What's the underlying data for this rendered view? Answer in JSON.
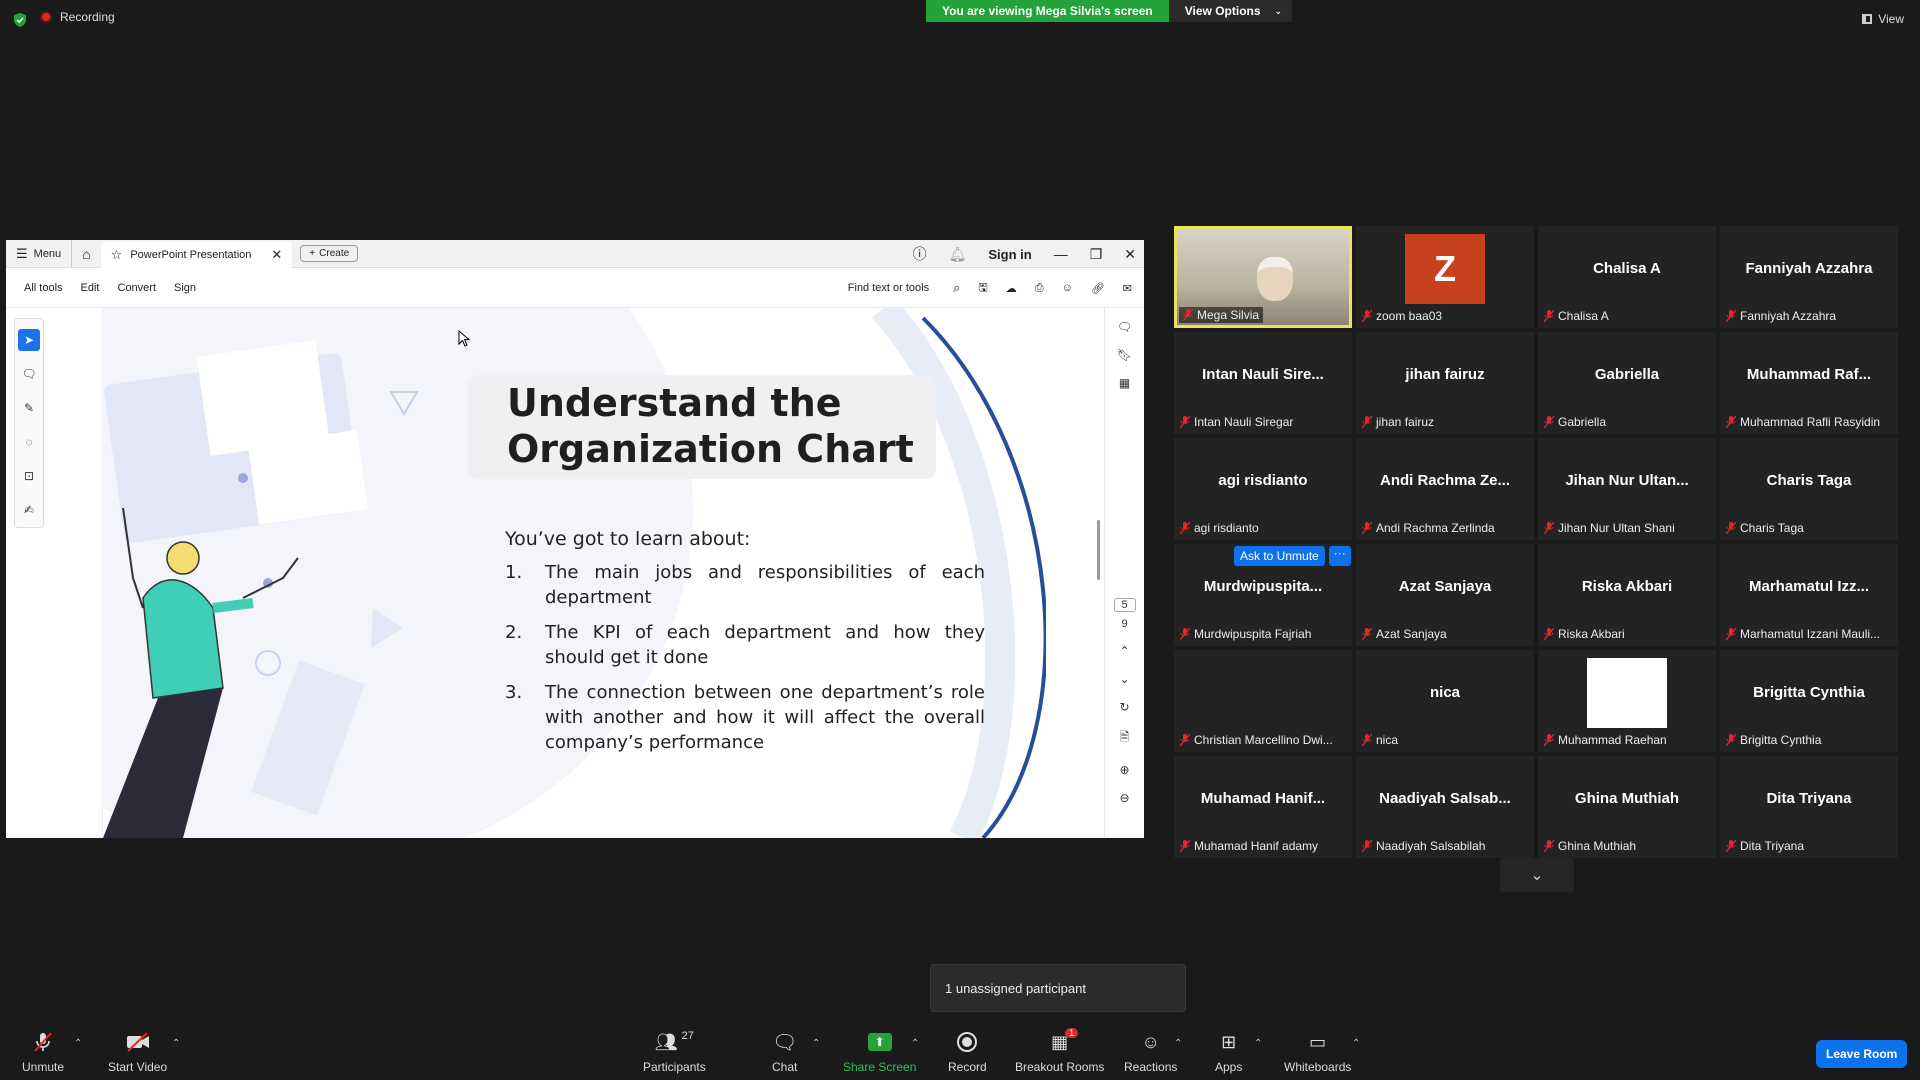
{
  "topbar": {
    "recording": "Recording",
    "viewing": "You are viewing Mega Silvia's screen",
    "view_options": "View Options",
    "view": "View"
  },
  "share": {
    "menu": "Menu",
    "tab_title": "PowerPoint Presentation",
    "create": "Create",
    "sign_in": "Sign in",
    "toolbar": [
      "All tools",
      "Edit",
      "Convert",
      "Sign"
    ],
    "find": "Find text or tools",
    "page_current": "5",
    "page_total": "9",
    "slide": {
      "title_line1": "Understand the",
      "title_line2": "Organization Chart",
      "intro": "You’ve got to learn about:",
      "items": [
        {
          "num": "1.",
          "text": "The main jobs and responsibilities of each department"
        },
        {
          "num": "2.",
          "text": "The KPI of each department and how they should get it done"
        },
        {
          "num": "3.",
          "text": "The connection between one department’s role with another and how it will affect the overall company’s performance"
        }
      ]
    }
  },
  "participants": [
    {
      "big": "",
      "label": "Mega Silvia"
    },
    {
      "big": "Z",
      "label": "zoom baa03"
    },
    {
      "big": "Chalisa A",
      "label": "Chalisa A"
    },
    {
      "big": "Fanniyah Azzahra",
      "label": "Fanniyah Azzahra"
    },
    {
      "big": "Intan Nauli Sire...",
      "label": "Intan Nauli Siregar"
    },
    {
      "big": "jihan fairuz",
      "label": "jihan fairuz"
    },
    {
      "big": "Gabriella",
      "label": "Gabriella"
    },
    {
      "big": "Muhammad Raf...",
      "label": "Muhammad Rafli Rasyidin"
    },
    {
      "big": "agi risdianto",
      "label": "agi risdianto"
    },
    {
      "big": "Andi Rachma Ze...",
      "label": "Andi Rachma Zerlinda"
    },
    {
      "big": "Jihan Nur Ultan...",
      "label": "Jihan Nur Ultan Shani"
    },
    {
      "big": "Charis Taga",
      "label": "Charis Taga"
    },
    {
      "big": "Murdwipuspita...",
      "label": "Murdwipuspita Fajriah"
    },
    {
      "big": "Azat Sanjaya",
      "label": "Azat Sanjaya"
    },
    {
      "big": "Riska Akbari",
      "label": "Riska Akbari"
    },
    {
      "big": "Marhamatul Izz...",
      "label": "Marhamatul Izzani Mauli..."
    },
    {
      "big": "",
      "label": "Christian Marcellino Dwi..."
    },
    {
      "big": "nica",
      "label": "nica"
    },
    {
      "big": "",
      "label": "Muhammad Raehan"
    },
    {
      "big": "Brigitta Cynthia",
      "label": "Brigitta Cynthia"
    },
    {
      "big": "Muhamad Hanif...",
      "label": "Muhamad Hanif adamy"
    },
    {
      "big": "Naadiyah Salsab...",
      "label": "Naadiyah Salsabilah"
    },
    {
      "big": "Ghina Muthiah",
      "label": "Ghina Muthiah"
    },
    {
      "big": "Dita Triyana",
      "label": "Dita Triyana"
    }
  ],
  "ask_unmute": "Ask to Unmute",
  "ask_more": "···",
  "toast": "1 unassigned participant",
  "bottom": {
    "unmute": "Unmute",
    "start_video": "Start Video",
    "participants": "Participants",
    "participants_count": "27",
    "chat": "Chat",
    "share_screen": "Share Screen",
    "record": "Record",
    "breakout_rooms": "Breakout Rooms",
    "breakout_badge": "1",
    "reactions": "Reactions",
    "apps": "Apps",
    "whiteboards": "Whiteboards",
    "leave": "Leave Room"
  },
  "colors": {
    "share_green": "#23a33a",
    "zoom_blue": "#0e72ed",
    "active_border": "#e8e35a",
    "avatar_z": "#c8411d"
  }
}
